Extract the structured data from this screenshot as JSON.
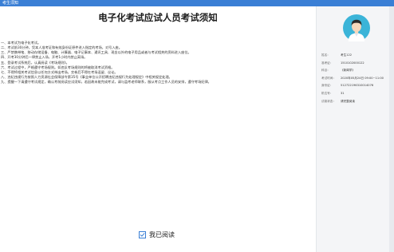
{
  "window": {
    "title": "考生须知"
  },
  "page": {
    "title": "电子化考试应试人员考试须知"
  },
  "rules": [
    "一、本考试为电子化考试。",
    "二、考试前30分钟，凭本人准考证和有效身份证原件进入指定的考场，对号入座。",
    "三、严禁携带笔、移动存储设备、电脑、计算器、电子记事本、通讯工具、现金以外的电子用品或者与考试相关的资料进入座位。",
    "四、开考30分钟后一律禁止入场，开考1小时内禁止离场。",
    "五、登录考试系统后，认真阅读《考场规则》。",
    "六、考试过程中，严格遵守考场规则。如违反考场规则的将被取消考试资格。",
    "七、不得将相关考试信息以任何方式带出考场，交卷后不得在考场逗留、议论。",
    "八、违纪违规行为按照人力资源社会保障部令第35号《事业单位公开招聘违纪违规行为处理规定》中相关规定处理。",
    "九、提醒一下请遵守考试规定，确认考前阅读应试须知，若因故未能完成考试，请与监考老师联系，服从考点工作人员的安排，遵守考场纪律。"
  ],
  "read_checkbox": {
    "label": "我已阅读",
    "checked": true,
    "check_glyph": "✓"
  },
  "profile": {
    "avatar_icon": "user-avatar-icon",
    "fields": [
      {
        "label": "姓名：",
        "value": "考生122"
      },
      {
        "label": "准考证：",
        "value": "1510102000122"
      },
      {
        "label": "科目：",
        "value": "《新闻学》"
      },
      {
        "label": "考试时间：",
        "value": "2020年05月24日 09:00~11:00"
      },
      {
        "label": "身份证：",
        "value": "512722196310014076"
      },
      {
        "label": "机位号：",
        "value": "31"
      },
      {
        "label": "试卷状态：",
        "value": "请完整阅读"
      }
    ]
  },
  "colors": {
    "accent": "#3a7fd5",
    "avatar_bg": "#3bb4d8",
    "avatar_face": "#f6d7bb",
    "avatar_hair": "#2b2b2b"
  }
}
